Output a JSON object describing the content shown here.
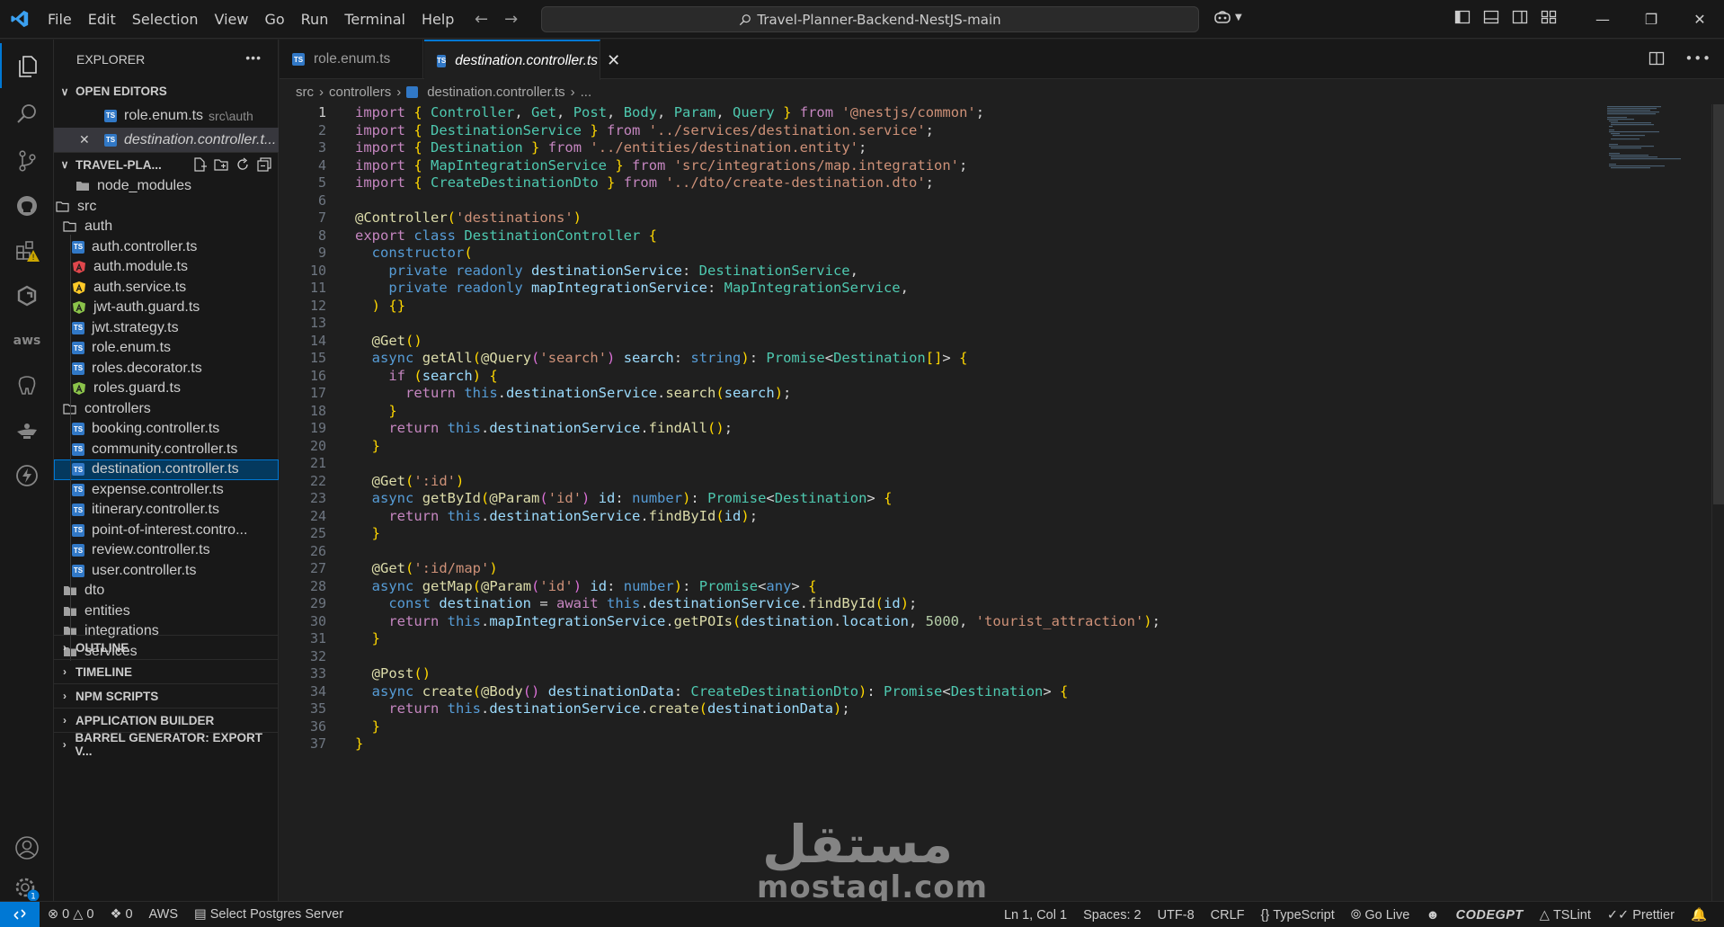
{
  "titlebar": {
    "menus": [
      "File",
      "Edit",
      "Selection",
      "View",
      "Go",
      "Run",
      "Terminal",
      "Help"
    ],
    "search_text": "Travel-Planner-Backend-NestJS-main"
  },
  "sidebar": {
    "title": "EXPLORER",
    "open_editors": {
      "header": "OPEN EDITORS",
      "items": [
        {
          "name": "role.enum.ts",
          "desc": "src\\auth"
        },
        {
          "name": "destination.controller.t..."
        }
      ]
    },
    "project": {
      "header": "TRAVEL-PLA...",
      "tree": [
        {
          "label": "node_modules",
          "kind": "folder-closed"
        },
        {
          "label": "src",
          "kind": "folder-open"
        },
        {
          "label": "auth",
          "kind": "folder-open"
        },
        {
          "label": "auth.controller.ts",
          "kind": "ts"
        },
        {
          "label": "auth.module.ts",
          "kind": "angular-red"
        },
        {
          "label": "auth.service.ts",
          "kind": "angular-yellow"
        },
        {
          "label": "jwt-auth.guard.ts",
          "kind": "angular-green"
        },
        {
          "label": "jwt.strategy.ts",
          "kind": "ts"
        },
        {
          "label": "role.enum.ts",
          "kind": "ts"
        },
        {
          "label": "roles.decorator.ts",
          "kind": "ts"
        },
        {
          "label": "roles.guard.ts",
          "kind": "angular-green"
        },
        {
          "label": "controllers",
          "kind": "folder-open"
        },
        {
          "label": "booking.controller.ts",
          "kind": "ts"
        },
        {
          "label": "community.controller.ts",
          "kind": "ts"
        },
        {
          "label": "destination.controller.ts",
          "kind": "ts"
        },
        {
          "label": "expense.controller.ts",
          "kind": "ts"
        },
        {
          "label": "itinerary.controller.ts",
          "kind": "ts"
        },
        {
          "label": "point-of-interest.contro...",
          "kind": "ts"
        },
        {
          "label": "review.controller.ts",
          "kind": "ts"
        },
        {
          "label": "user.controller.ts",
          "kind": "ts"
        },
        {
          "label": "dto",
          "kind": "folder-closed"
        },
        {
          "label": "entities",
          "kind": "folder-closed"
        },
        {
          "label": "integrations",
          "kind": "folder-closed"
        },
        {
          "label": "services",
          "kind": "folder-closed"
        }
      ]
    },
    "bottom_sections": [
      "OUTLINE",
      "TIMELINE",
      "NPM SCRIPTS",
      "APPLICATION BUILDER",
      "BARREL GENERATOR: EXPORT V..."
    ]
  },
  "tabs": [
    {
      "label": "role.enum.ts",
      "active": false
    },
    {
      "label": "destination.controller.ts",
      "active": true
    }
  ],
  "breadcrumb": [
    "src",
    "controllers",
    "destination.controller.ts",
    "..."
  ],
  "editor": {
    "line_numbers": [
      "1",
      "2",
      "3",
      "4",
      "5",
      "6",
      "7",
      "8",
      "9",
      "10",
      "11",
      "12",
      "13",
      "14",
      "15",
      "16",
      "17",
      "18",
      "19",
      "20",
      "21",
      "22",
      "23",
      "24",
      "25",
      "26",
      "27",
      "28",
      "29",
      "30",
      "31",
      "32",
      "33",
      "34",
      "35",
      "36",
      "37"
    ],
    "lines": [
      "import { Controller, Get, Post, Body, Param, Query } from '@nestjs/common';",
      "import { DestinationService } from '../services/destination.service';",
      "import { Destination } from '../entities/destination.entity';",
      "import { MapIntegrationService } from 'src/integrations/map.integration';",
      "import { CreateDestinationDto } from '../dto/create-destination.dto';",
      "",
      "@Controller('destinations')",
      "export class DestinationController {",
      "  constructor(",
      "    private readonly destinationService: DestinationService,",
      "    private readonly mapIntegrationService: MapIntegrationService,",
      "  ) {}",
      "",
      "  @Get()",
      "  async getAll(@Query('search') search: string): Promise<Destination[]> {",
      "    if (search) {",
      "      return this.destinationService.search(search);",
      "    }",
      "    return this.destinationService.findAll();",
      "  }",
      "",
      "  @Get(':id')",
      "  async getById(@Param('id') id: number): Promise<Destination> {",
      "    return this.destinationService.findById(id);",
      "  }",
      "",
      "  @Get(':id/map')",
      "  async getMap(@Param('id') id: number): Promise<any> {",
      "    const destination = await this.destinationService.findById(id);",
      "    return this.mapIntegrationService.getPOIs(destination.location, 5000, 'tourist_attraction');",
      "  }",
      "",
      "  @Post()",
      "  async create(@Body() destinationData: CreateDestinationDto): Promise<Destination> {",
      "    return this.destinationService.create(destinationData);",
      "  }",
      "}"
    ]
  },
  "statusbar": {
    "errors": "0",
    "warnings": "0",
    "ports": "0",
    "aws": "AWS",
    "postgres": "Select Postgres Server",
    "cursor": "Ln 1, Col 1",
    "spaces": "Spaces: 2",
    "encoding": "UTF-8",
    "eol": "CRLF",
    "language": "TypeScript",
    "golive": "Go Live",
    "codegpt": "CODEGPT",
    "tslint": "TSLint",
    "prettier": "Prettier",
    "settings_badge": "1"
  },
  "watermark": {
    "arabic": "مستقل",
    "latin": "mostaql.com"
  },
  "colors": {
    "accent": "#0078d4",
    "selection": "#04395e",
    "ts_icon": "#3178c6"
  }
}
